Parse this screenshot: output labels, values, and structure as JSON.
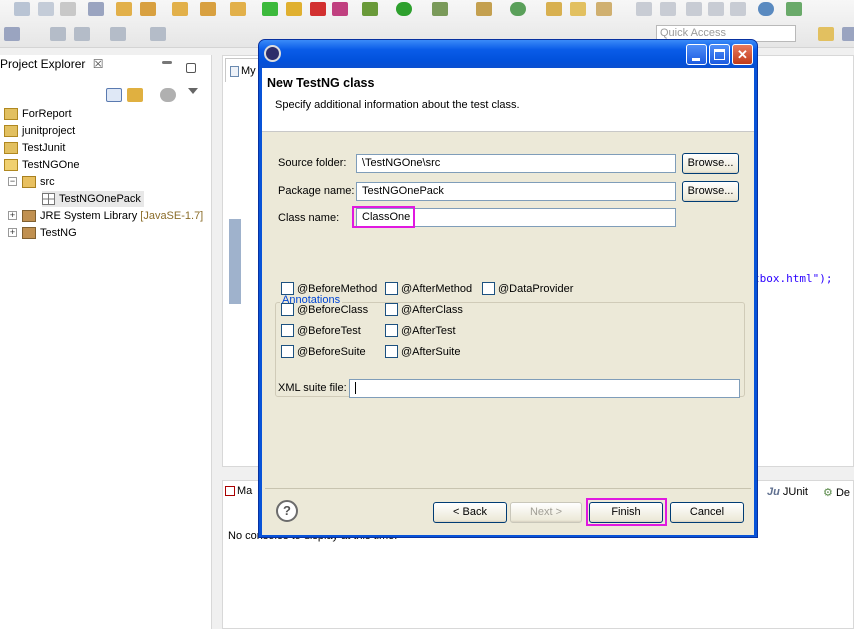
{
  "toolbar": {
    "quick_access_placeholder": "Quick Access"
  },
  "explorer": {
    "title": "Project Explorer",
    "tab_close": "☒",
    "items": [
      {
        "label": "ForReport"
      },
      {
        "label": "junitproject"
      },
      {
        "label": "TestJunit"
      },
      {
        "label": "TestNGOne"
      },
      {
        "label": "src"
      },
      {
        "label": "TestNGOnePack"
      },
      {
        "label": "JRE System Library",
        "suffix": "[JavaSE-1.7]"
      },
      {
        "label": "TestNG"
      }
    ]
  },
  "editor": {
    "tab_label": "My",
    "code_fragment": "tbox.html\");"
  },
  "console": {
    "tab_label": "Ma",
    "junit_tab": "JUnit",
    "de_tab": "De",
    "message": "No consoles to display at this time."
  },
  "dialog": {
    "title_bar_text": "",
    "header_title": "New TestNG class",
    "header_desc": "Specify additional information about the test class.",
    "source_folder_label": "Source folder:",
    "source_folder_value": "\\TestNGOne\\src",
    "package_name_label": "Package name:",
    "package_name_value": "TestNGOnePack",
    "class_name_label": "Class name:",
    "class_name_value": "ClassOne",
    "browse_label": "Browse...",
    "annotations_label": "Annotations",
    "annotations": [
      "@BeforeMethod",
      "@AfterMethod",
      "@DataProvider",
      "@BeforeClass",
      "@AfterClass",
      "@BeforeTest",
      "@AfterTest",
      "@BeforeSuite",
      "@AfterSuite"
    ],
    "xml_suite_label": "XML suite file:",
    "xml_suite_value": "",
    "help_label": "?",
    "back_label": "< Back",
    "next_label": "Next >",
    "finish_label": "Finish",
    "cancel_label": "Cancel"
  },
  "colors": {
    "highlight": "#e019e0",
    "titlebar": "#0a5ce8",
    "dialog_bg": "#ece9d8",
    "annotations_legend": "#0046d5"
  }
}
